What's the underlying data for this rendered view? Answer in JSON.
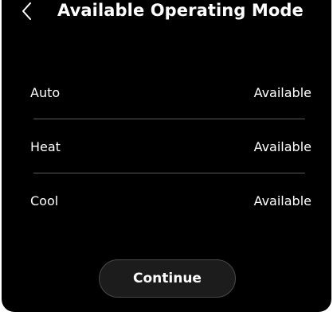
{
  "header": {
    "back_icon": "chevron-left-icon",
    "title": "Available Operating Mode"
  },
  "modes": [
    {
      "name": "Auto",
      "status": "Available"
    },
    {
      "name": "Heat",
      "status": "Available"
    },
    {
      "name": "Cool",
      "status": "Available"
    }
  ],
  "footer": {
    "continue_label": "Continue"
  },
  "colors": {
    "background": "#000000",
    "text": "#ffffff",
    "divider": "#5a5a5a",
    "button_bg": "#1c1c1c",
    "button_border": "#4a4a4a"
  }
}
